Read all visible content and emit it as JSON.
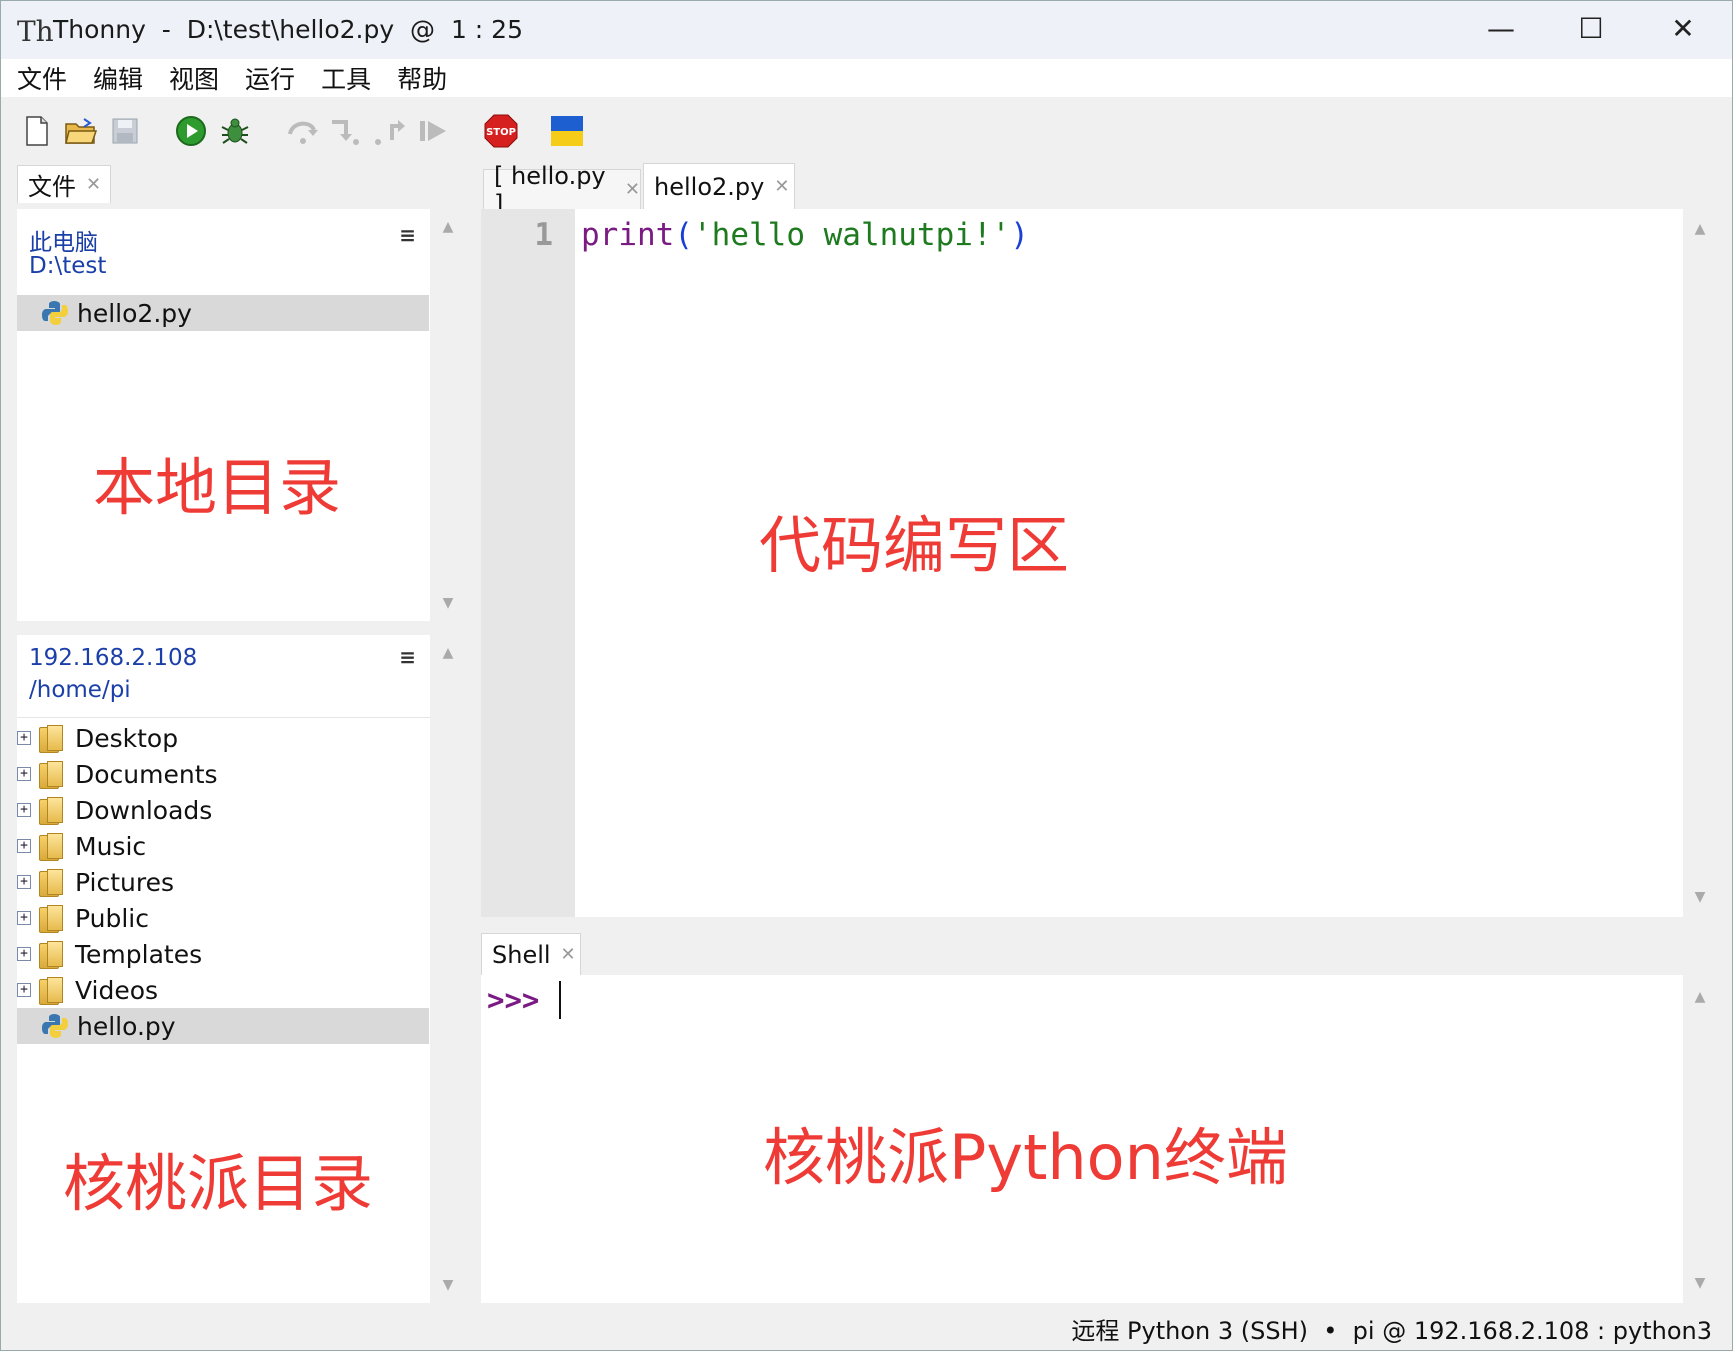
{
  "window": {
    "app_name": "Thonny",
    "title": "Thonny  -  D:\\test\\hello2.py  @  1 : 25",
    "controls": {
      "minimize": "—",
      "maximize": "☐",
      "close": "✕"
    }
  },
  "menu": [
    "文件",
    "编辑",
    "视图",
    "运行",
    "工具",
    "帮助"
  ],
  "toolbar": {
    "icons": [
      "new-file-icon",
      "open-folder-icon",
      "save-icon",
      "run-icon",
      "debug-icon",
      "step-over-icon",
      "step-into-icon",
      "step-out-icon",
      "resume-icon",
      "stop-icon",
      "ukraine-flag-icon"
    ],
    "stop_label": "STOP"
  },
  "files_panel": {
    "tab_label": "文件",
    "local": {
      "header_line1": "此电脑",
      "header_line2": "D:\\test",
      "files": [
        "hello2.py"
      ]
    },
    "remote": {
      "header_line1": "192.168.2.108",
      "header_line2": "/home/pi",
      "folders": [
        "Desktop",
        "Documents",
        "Downloads",
        "Music",
        "Pictures",
        "Public",
        "Templates",
        "Videos"
      ],
      "files": [
        "hello.py"
      ]
    }
  },
  "editor": {
    "tabs": [
      {
        "label": "[ hello.py ]",
        "active": false
      },
      {
        "label": "hello2.py",
        "active": true
      }
    ],
    "line_number": "1",
    "code": {
      "func": "print",
      "open": "(",
      "string": "'hello walnutpi!'",
      "close": ")"
    }
  },
  "shell": {
    "tab_label": "Shell",
    "prompt": ">>>"
  },
  "annotations": {
    "local_dir": "本地目录",
    "code_area": "代码编写区",
    "remote_dir": "核桃派目录",
    "terminal": "核桃派Python终端"
  },
  "status_bar": "远程 Python 3 (SSH)  •  pi @ 192.168.2.108 : python3",
  "colors": {
    "annotation": "#ef3b36",
    "keyword": "#7a1a83",
    "string": "#1e7a1e",
    "paren": "#1a3fd6",
    "prompt": "#7a1a83",
    "link": "#1a3fa8"
  }
}
